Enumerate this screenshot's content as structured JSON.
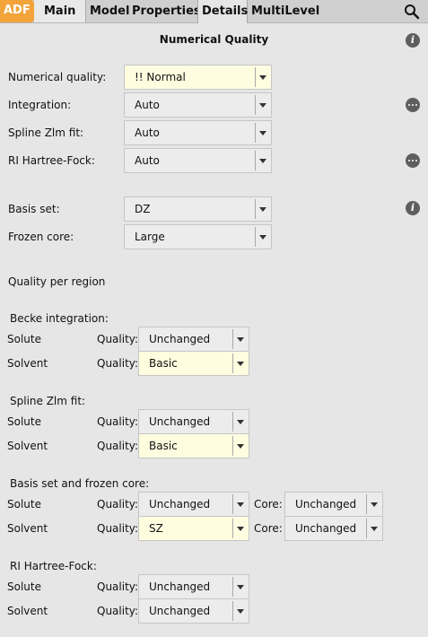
{
  "tabs": {
    "adf": "ADF",
    "main": "Main",
    "model": "Model",
    "properties": "Properties",
    "details": "Details",
    "multilevel": "MultiLevel"
  },
  "panel_title": "Numerical Quality",
  "fields": {
    "numerical_quality": {
      "label": "Numerical quality:",
      "value": "!! Normal"
    },
    "integration": {
      "label": "Integration:",
      "value": "Auto"
    },
    "spline": {
      "label": "Spline Zlm fit:",
      "value": "Auto"
    },
    "ri_hf": {
      "label": "RI Hartree-Fock:",
      "value": "Auto"
    },
    "basis_set": {
      "label": "Basis set:",
      "value": "DZ"
    },
    "frozen_core": {
      "label": "Frozen core:",
      "value": "Large"
    }
  },
  "quality_per_region": "Quality per region",
  "groups": {
    "becke": {
      "heading": "Becke integration:",
      "solute": {
        "region": "Solute",
        "quality_label": "Quality:",
        "quality": "Unchanged"
      },
      "solvent": {
        "region": "Solvent",
        "quality_label": "Quality:",
        "quality": "Basic"
      }
    },
    "spline": {
      "heading": "Spline Zlm fit:",
      "solute": {
        "region": "Solute",
        "quality_label": "Quality:",
        "quality": "Unchanged"
      },
      "solvent": {
        "region": "Solvent",
        "quality_label": "Quality:",
        "quality": "Basic"
      }
    },
    "basis": {
      "heading": "Basis set and frozen core:",
      "solute": {
        "region": "Solute",
        "quality_label": "Quality:",
        "quality": "Unchanged",
        "core_label": "Core:",
        "core": "Unchanged"
      },
      "solvent": {
        "region": "Solvent",
        "quality_label": "Quality:",
        "quality": "SZ",
        "core_label": "Core:",
        "core": "Unchanged"
      }
    },
    "rihf": {
      "heading": "RI Hartree-Fock:",
      "solute": {
        "region": "Solute",
        "quality_label": "Quality:",
        "quality": "Unchanged"
      },
      "solvent": {
        "region": "Solvent",
        "quality_label": "Quality:",
        "quality": "Unchanged"
      }
    }
  },
  "colors": {
    "accent_tab": "#f2a43a",
    "highlight_field": "#fefde0",
    "background": "#e6e6e6"
  },
  "icons": {
    "search": "search-icon",
    "info": "info-icon",
    "more": "more-options-icon"
  }
}
